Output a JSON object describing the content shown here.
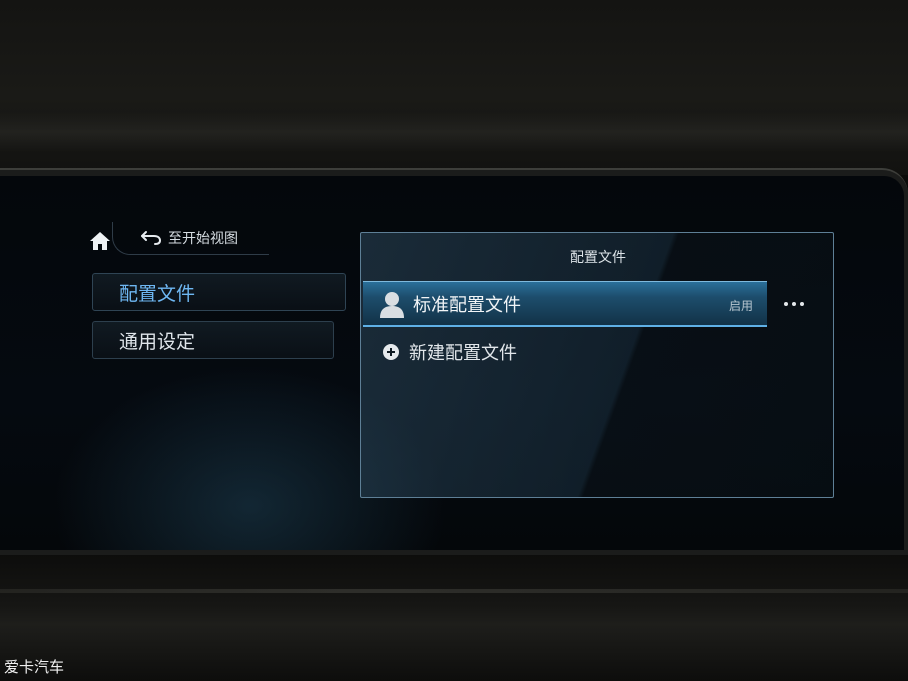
{
  "header": {
    "back_label": "至开始视图"
  },
  "sidebar": {
    "items": [
      {
        "label": "配置文件",
        "active": true
      },
      {
        "label": "通用设定",
        "active": false
      }
    ]
  },
  "panel": {
    "title": "配置文件",
    "profiles": [
      {
        "name": "标准配置文件",
        "status": "启用",
        "icon": "user-icon"
      }
    ],
    "new_profile_label": "新建配置文件"
  },
  "watermark": "爱卡汽车",
  "colors": {
    "accent": "#6eb7f2",
    "selection": "#2a6f9a",
    "background": "#04070b"
  }
}
